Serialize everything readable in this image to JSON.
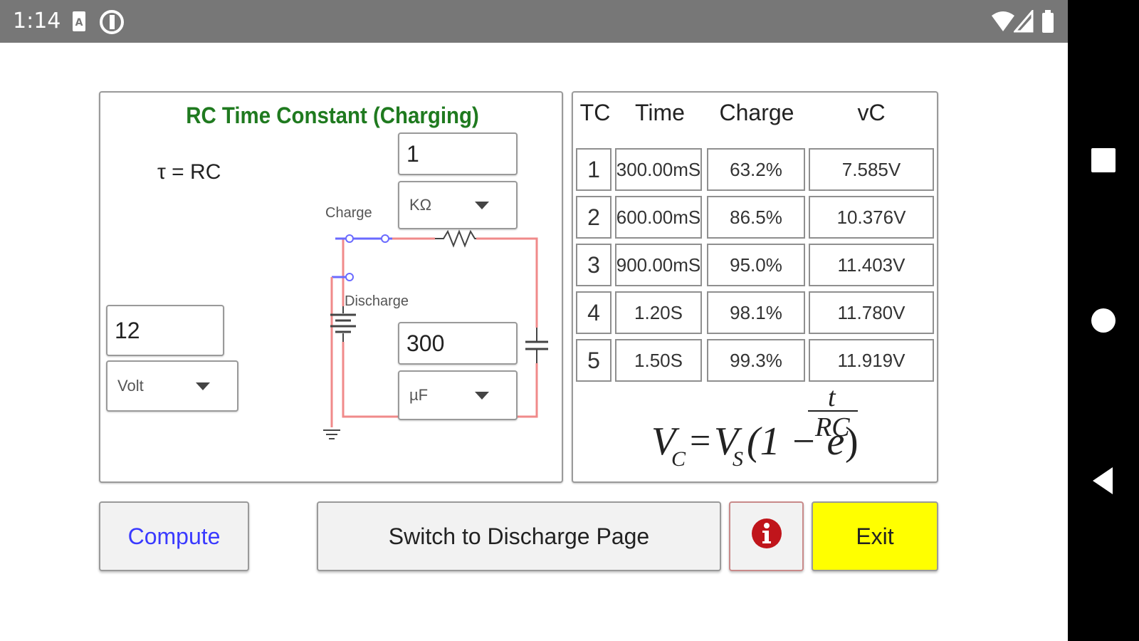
{
  "status_bar": {
    "time": "1:14"
  },
  "calculator": {
    "title": "RC Time Constant (Charging)",
    "tau_formula": "τ = RC",
    "resistance": {
      "value": "1",
      "unit": "KΩ"
    },
    "voltage": {
      "value": "12",
      "unit": "Volt"
    },
    "capacitance": {
      "value": "300",
      "unit": "µF"
    },
    "labels": {
      "charge": "Charge",
      "discharge": "Discharge"
    }
  },
  "table": {
    "headers": [
      "TC",
      "Time",
      "Charge",
      "vC"
    ],
    "rows": [
      {
        "tc": "1",
        "time": "300.00mS",
        "charge": "63.2%",
        "vc": "7.585V"
      },
      {
        "tc": "2",
        "time": "600.00mS",
        "charge": "86.5%",
        "vc": "10.376V"
      },
      {
        "tc": "3",
        "time": "900.00mS",
        "charge": "95.0%",
        "vc": "11.403V"
      },
      {
        "tc": "4",
        "time": "1.20S",
        "charge": "98.1%",
        "vc": "11.780V"
      },
      {
        "tc": "5",
        "time": "1.50S",
        "charge": "99.3%",
        "vc": "11.919V"
      }
    ],
    "formula": {
      "lhs": "V",
      "lhs_sub": "C",
      "eq": "=",
      "vs": "V",
      "vs_sub": "S",
      "open": "(1 − e",
      "exp_num": "t",
      "exp_den": "RC",
      "close": ")"
    }
  },
  "buttons": {
    "compute": "Compute",
    "switch": "Switch to Discharge Page",
    "exit": "Exit"
  },
  "colors": {
    "title_green": "#1f7a1f",
    "compute_text": "#3a3aff",
    "exit_bg": "#ffff00",
    "info_red": "#c0151b",
    "wire_red": "#f08a8a",
    "wire_blue": "#6a6aff"
  }
}
